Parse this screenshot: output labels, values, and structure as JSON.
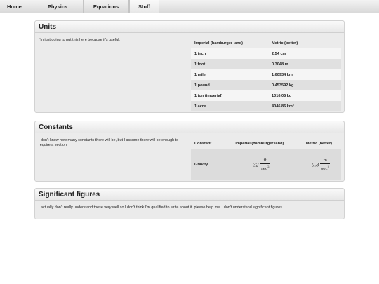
{
  "nav": {
    "items": [
      {
        "label": "Home"
      },
      {
        "label": "Physics"
      },
      {
        "label": "Equations"
      },
      {
        "label": "Stuff"
      }
    ],
    "active": "Stuff"
  },
  "units": {
    "title": "Units",
    "text": "I'm just going to put this here because it's useful.",
    "headers": [
      "Imperial (hamburger land)",
      "Metric (better)"
    ],
    "rows": [
      [
        "1 inch",
        "2.54 cm"
      ],
      [
        "1 foot",
        "0.3048 m"
      ],
      [
        "1 mile",
        "1.60934 km"
      ],
      [
        "1 pound",
        "0.453592 kg"
      ],
      [
        "1 ton (imperial)",
        "1016.05 kg"
      ],
      [
        "1 acre",
        "4046.86 km²"
      ]
    ]
  },
  "constants": {
    "title": "Constants",
    "text": "I don't know how many constants there will be, but I assume there will be enough to require a section.",
    "headers": [
      "Constant",
      "Imperial (hamburger land)",
      "Metric (better)"
    ],
    "rows": [
      {
        "name": "Gravity",
        "imperial": {
          "coef": "−32",
          "num": "ft",
          "den": "sec",
          "exp": "2"
        },
        "metric": {
          "coef": "−9.8",
          "num": "m",
          "den": "sec",
          "exp": "2"
        }
      }
    ]
  },
  "sigfigs": {
    "title": "Significant figures",
    "text": "I actually don't really understand these very well so I don't think I'm qualified to write about it. please help me. i don't understand significant figures."
  }
}
